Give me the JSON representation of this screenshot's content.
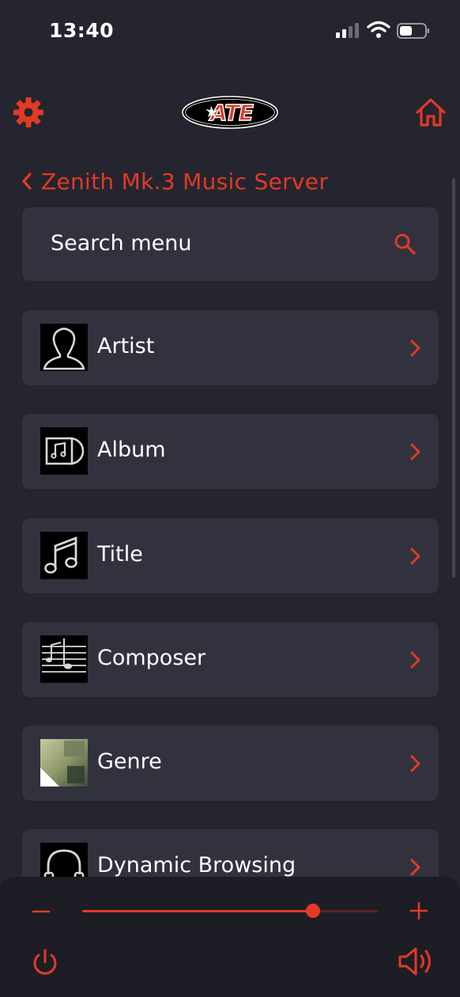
{
  "status_bar": {
    "time": "13:40"
  },
  "header": {
    "settings_icon": "gear-icon",
    "logo_text": "ATE",
    "home_icon": "home-icon"
  },
  "breadcrumb": {
    "back_icon": "chevron-left-icon",
    "title": "Zenith Mk.3 Music Server"
  },
  "search": {
    "placeholder": "Search menu",
    "icon": "search-icon"
  },
  "menu": {
    "items": [
      {
        "label": "Artist",
        "icon": "artist-icon"
      },
      {
        "label": "Album",
        "icon": "album-icon"
      },
      {
        "label": "Title",
        "icon": "music-note-icon"
      },
      {
        "label": "Composer",
        "icon": "composer-icon"
      },
      {
        "label": "Genre",
        "icon": "genre-cover-art"
      },
      {
        "label": "Dynamic Browsing",
        "icon": "headphones-icon"
      }
    ]
  },
  "volume": {
    "level_percent": 78,
    "minus_icon": "minus-icon",
    "plus_icon": "plus-icon"
  },
  "controls": {
    "power_icon": "power-icon",
    "speaker_icon": "speaker-icon"
  },
  "colors": {
    "accent": "#e23a25",
    "background": "#25252f",
    "card": "#32323f",
    "bottom_panel": "#1d1d26"
  }
}
